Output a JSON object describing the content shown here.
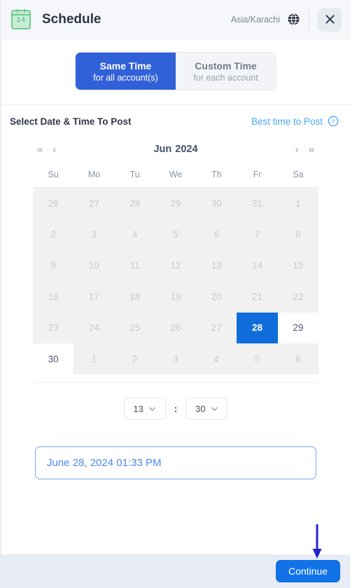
{
  "header": {
    "icon_name": "calendar-icon",
    "icon_day": "14",
    "title": "Schedule",
    "timezone": "Asia/Karachi",
    "globe_icon": "globe-icon",
    "close_icon": "close-icon"
  },
  "mode_toggle": {
    "same_time": {
      "main": "Same Time",
      "sub": "for all account(s)",
      "active": true
    },
    "custom_time": {
      "main": "Custom Time",
      "sub": "for each account",
      "active": false
    }
  },
  "section": {
    "title": "Select Date & Time To Post",
    "best_time_label": "Best time to Post",
    "help_icon": "question-circle-icon"
  },
  "calendar": {
    "month": "Jun",
    "year": "2024",
    "nav": {
      "prev_year": "«",
      "prev_month": "‹",
      "next_month": "›",
      "next_year": "»"
    },
    "weekdays": [
      "Su",
      "Mo",
      "Tu",
      "We",
      "Th",
      "Fr",
      "Sa"
    ],
    "weeks": [
      [
        {
          "d": "26",
          "state": "disabled"
        },
        {
          "d": "27",
          "state": "disabled"
        },
        {
          "d": "28",
          "state": "disabled"
        },
        {
          "d": "29",
          "state": "disabled"
        },
        {
          "d": "30",
          "state": "disabled"
        },
        {
          "d": "31",
          "state": "disabled"
        },
        {
          "d": "1",
          "state": "disabled"
        }
      ],
      [
        {
          "d": "2",
          "state": "disabled"
        },
        {
          "d": "3",
          "state": "disabled"
        },
        {
          "d": "4",
          "state": "disabled"
        },
        {
          "d": "5",
          "state": "disabled"
        },
        {
          "d": "6",
          "state": "disabled"
        },
        {
          "d": "7",
          "state": "disabled"
        },
        {
          "d": "8",
          "state": "disabled"
        }
      ],
      [
        {
          "d": "9",
          "state": "disabled"
        },
        {
          "d": "10",
          "state": "disabled"
        },
        {
          "d": "11",
          "state": "disabled"
        },
        {
          "d": "12",
          "state": "disabled"
        },
        {
          "d": "13",
          "state": "disabled"
        },
        {
          "d": "14",
          "state": "disabled"
        },
        {
          "d": "15",
          "state": "disabled"
        }
      ],
      [
        {
          "d": "16",
          "state": "disabled"
        },
        {
          "d": "17",
          "state": "disabled"
        },
        {
          "d": "18",
          "state": "disabled"
        },
        {
          "d": "19",
          "state": "disabled"
        },
        {
          "d": "20",
          "state": "disabled"
        },
        {
          "d": "21",
          "state": "disabled"
        },
        {
          "d": "22",
          "state": "disabled"
        }
      ],
      [
        {
          "d": "23",
          "state": "disabled"
        },
        {
          "d": "24",
          "state": "disabled"
        },
        {
          "d": "25",
          "state": "disabled"
        },
        {
          "d": "26",
          "state": "disabled"
        },
        {
          "d": "27",
          "state": "disabled"
        },
        {
          "d": "28",
          "state": "selected"
        },
        {
          "d": "29",
          "state": "enabled"
        }
      ],
      [
        {
          "d": "30",
          "state": "enabled"
        },
        {
          "d": "1",
          "state": "disabled"
        },
        {
          "d": "2",
          "state": "disabled"
        },
        {
          "d": "3",
          "state": "disabled"
        },
        {
          "d": "4",
          "state": "disabled"
        },
        {
          "d": "5",
          "state": "disabled"
        },
        {
          "d": "6",
          "state": "disabled"
        }
      ]
    ]
  },
  "time": {
    "hour": "13",
    "minute": "30",
    "separator": ":",
    "chevron_icon": "chevron-down-icon"
  },
  "date_field": {
    "value": "June 28, 2024 01:33 PM"
  },
  "footer": {
    "continue_label": "Continue"
  },
  "annotation": {
    "arrow": "down-arrow-annotation",
    "color": "#2222cc"
  },
  "colors": {
    "accent_blue": "#3161d8",
    "selected_blue": "#0e6ddb",
    "continue_blue": "#1172e8",
    "link_blue": "#4aa7f5",
    "field_blue": "#4d88ef",
    "calendar_icon_green": "#6dcb92",
    "footer_bg": "#e8ecf4",
    "header_bg": "#f5f7fa",
    "disabled_bg": "#f1f1f1"
  }
}
